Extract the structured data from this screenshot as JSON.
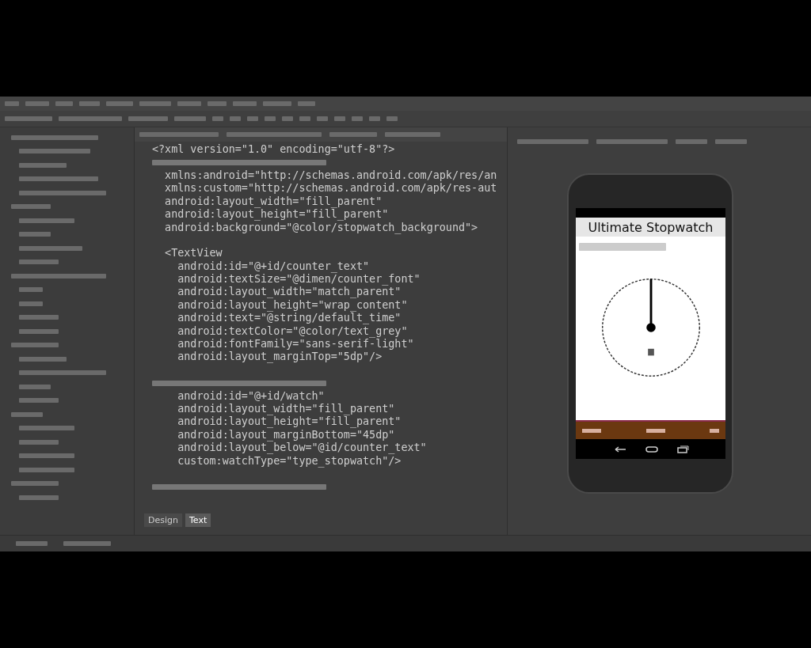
{
  "editor": {
    "lines": [
      {
        "kind": "code",
        "text": "<?xml version=\"1.0\" encoding=\"utf-8\"?>"
      },
      {
        "kind": "illegible"
      },
      {
        "kind": "code",
        "text": "  xmlns:android=\"http://schemas.android.com/apk/res/an"
      },
      {
        "kind": "code",
        "text": "  xmlns:custom=\"http://schemas.android.com/apk/res-aut"
      },
      {
        "kind": "code",
        "text": "  android:layout_width=\"fill_parent\""
      },
      {
        "kind": "code",
        "text": "  android:layout_height=\"fill_parent\""
      },
      {
        "kind": "code",
        "text": "  android:background=\"@color/stopwatch_background\">"
      },
      {
        "kind": "blank"
      },
      {
        "kind": "code",
        "text": "  <TextView"
      },
      {
        "kind": "code",
        "text": "    android:id=\"@+id/counter_text\""
      },
      {
        "kind": "code",
        "text": "    android:textSize=\"@dimen/counter_font\""
      },
      {
        "kind": "code",
        "text": "    android:layout_width=\"match_parent\""
      },
      {
        "kind": "code",
        "text": "    android:layout_height=\"wrap_content\""
      },
      {
        "kind": "code",
        "text": "    android:text=\"@string/default_time\""
      },
      {
        "kind": "code",
        "text": "    android:textColor=\"@color/text_grey\""
      },
      {
        "kind": "code",
        "text": "    android:fontFamily=\"sans-serif-light\""
      },
      {
        "kind": "code",
        "text": "    android:layout_marginTop=\"5dp\"/>"
      },
      {
        "kind": "blank"
      },
      {
        "kind": "illegible"
      },
      {
        "kind": "code",
        "text": "    android:id=\"@+id/watch\""
      },
      {
        "kind": "code",
        "text": "    android:layout_width=\"fill_parent\""
      },
      {
        "kind": "code",
        "text": "    android:layout_height=\"fill_parent\""
      },
      {
        "kind": "code",
        "text": "    android:layout_marginBottom=\"45dp\""
      },
      {
        "kind": "code",
        "text": "    android:layout_below=\"@id/counter_text\""
      },
      {
        "kind": "code",
        "text": "    custom:watchType=\"type_stopwatch\"/>"
      },
      {
        "kind": "blank"
      },
      {
        "kind": "illegible"
      }
    ],
    "view_tabs": [
      {
        "label": "Design",
        "selected": false
      },
      {
        "label": "Text",
        "selected": true
      }
    ]
  },
  "preview": {
    "app_title": "Ultimate Stopwatch"
  }
}
